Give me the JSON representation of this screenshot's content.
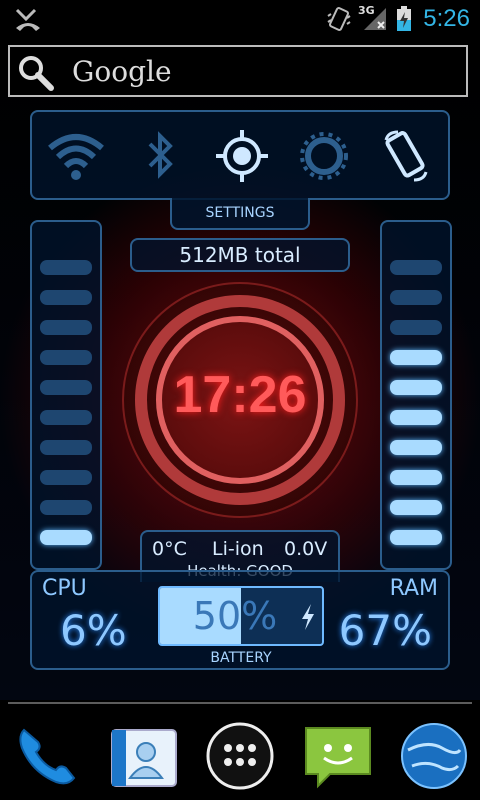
{
  "status_bar": {
    "network_label": "3G",
    "time": "5:26",
    "icons": [
      "missed-call-icon",
      "vibrate-icon",
      "signal-icon",
      "battery-charging-icon"
    ]
  },
  "search": {
    "label": "Google",
    "icon": "search-icon"
  },
  "widget": {
    "toggles": [
      "wifi-icon",
      "bluetooth-icon",
      "gps-icon",
      "brightness-icon",
      "rotate-icon"
    ],
    "settings_label": "SETTINGS",
    "memory_total": "512MB total",
    "clock_time": "17:26",
    "battery_info": {
      "temperature": "0°C",
      "type": "Li-ion",
      "voltage": "0.0V",
      "health": "Health: GOOD"
    },
    "cpu": {
      "label": "CPU",
      "value": "6%",
      "bars_on": 1,
      "bars_total": 10
    },
    "ram": {
      "label": "RAM",
      "value": "67%",
      "bars_on": 7,
      "bars_total": 10
    },
    "battery": {
      "value": "50%",
      "level": 0.5,
      "label": "BATTERY"
    }
  },
  "dock": [
    "phone-icon",
    "contacts-icon",
    "app-drawer-icon",
    "messaging-icon",
    "browser-icon"
  ],
  "colors": {
    "accent": "#33b5e5",
    "panel_border": "#2b5d8c",
    "bar_on": "#a9dbff",
    "clock_red": "#ff5a5a"
  }
}
